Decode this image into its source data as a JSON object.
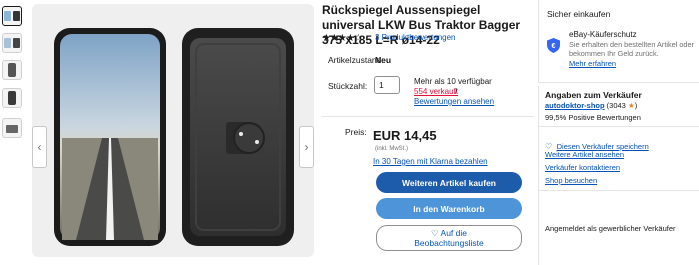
{
  "title": "Rückspiegel Aussenspiegel universal LKW Bus Traktor Bagger 375 x185 L=R ø14-22",
  "rating": {
    "stars": "★★★★☆",
    "reviews_link": "3 Produktbewertungen"
  },
  "condition": {
    "label": "Artikelzustand:",
    "value": "Neu"
  },
  "quantity": {
    "label": "Stückzahl:",
    "value": "1",
    "available": "Mehr als 10 verfügbar",
    "sold": "554 verkauft",
    "reviews_link": "Bewertungen ansehen"
  },
  "price": {
    "label": "Preis:",
    "value": "EUR 14,45",
    "tax_note": "(inkl. MwSt.)",
    "installment_link": "In 30 Tagen mit Klarna bezahlen"
  },
  "buttons": {
    "buy_now": "Weiteren Artikel kaufen",
    "add_to_cart": "In den Warenkorb",
    "watch_line1": "Auf die",
    "watch_line2": "Beobachtungsliste"
  },
  "gallery": {
    "prev": "‹",
    "next": "›"
  },
  "protection": {
    "heading": "Sicher einkaufen",
    "title": "eBay-Käuferschutz",
    "text": "Sie erhalten den bestellten Artikel oder bekommen Ihr Geld zurück.",
    "link": "Mehr erfahren"
  },
  "seller": {
    "heading": "Angaben zum Verkäufer",
    "name": "autodoktor-shop",
    "score": "(3043",
    "score_close": ")",
    "feedback": "99,5% Positive Bewertungen",
    "save_link": "Diesen Verkäufer speichern",
    "more_items_link": "Weitere Artikel ansehen",
    "contact_link": "Verkäufer kontaktieren",
    "shop_link": "Shop besuchen",
    "business_note": "Angemeldet als gewerblicher Verkäufer"
  },
  "colors": {
    "link": "#0654ba",
    "primary": "#1d5bab",
    "secondary": "#4d94d9",
    "sold": "#e0103a"
  }
}
